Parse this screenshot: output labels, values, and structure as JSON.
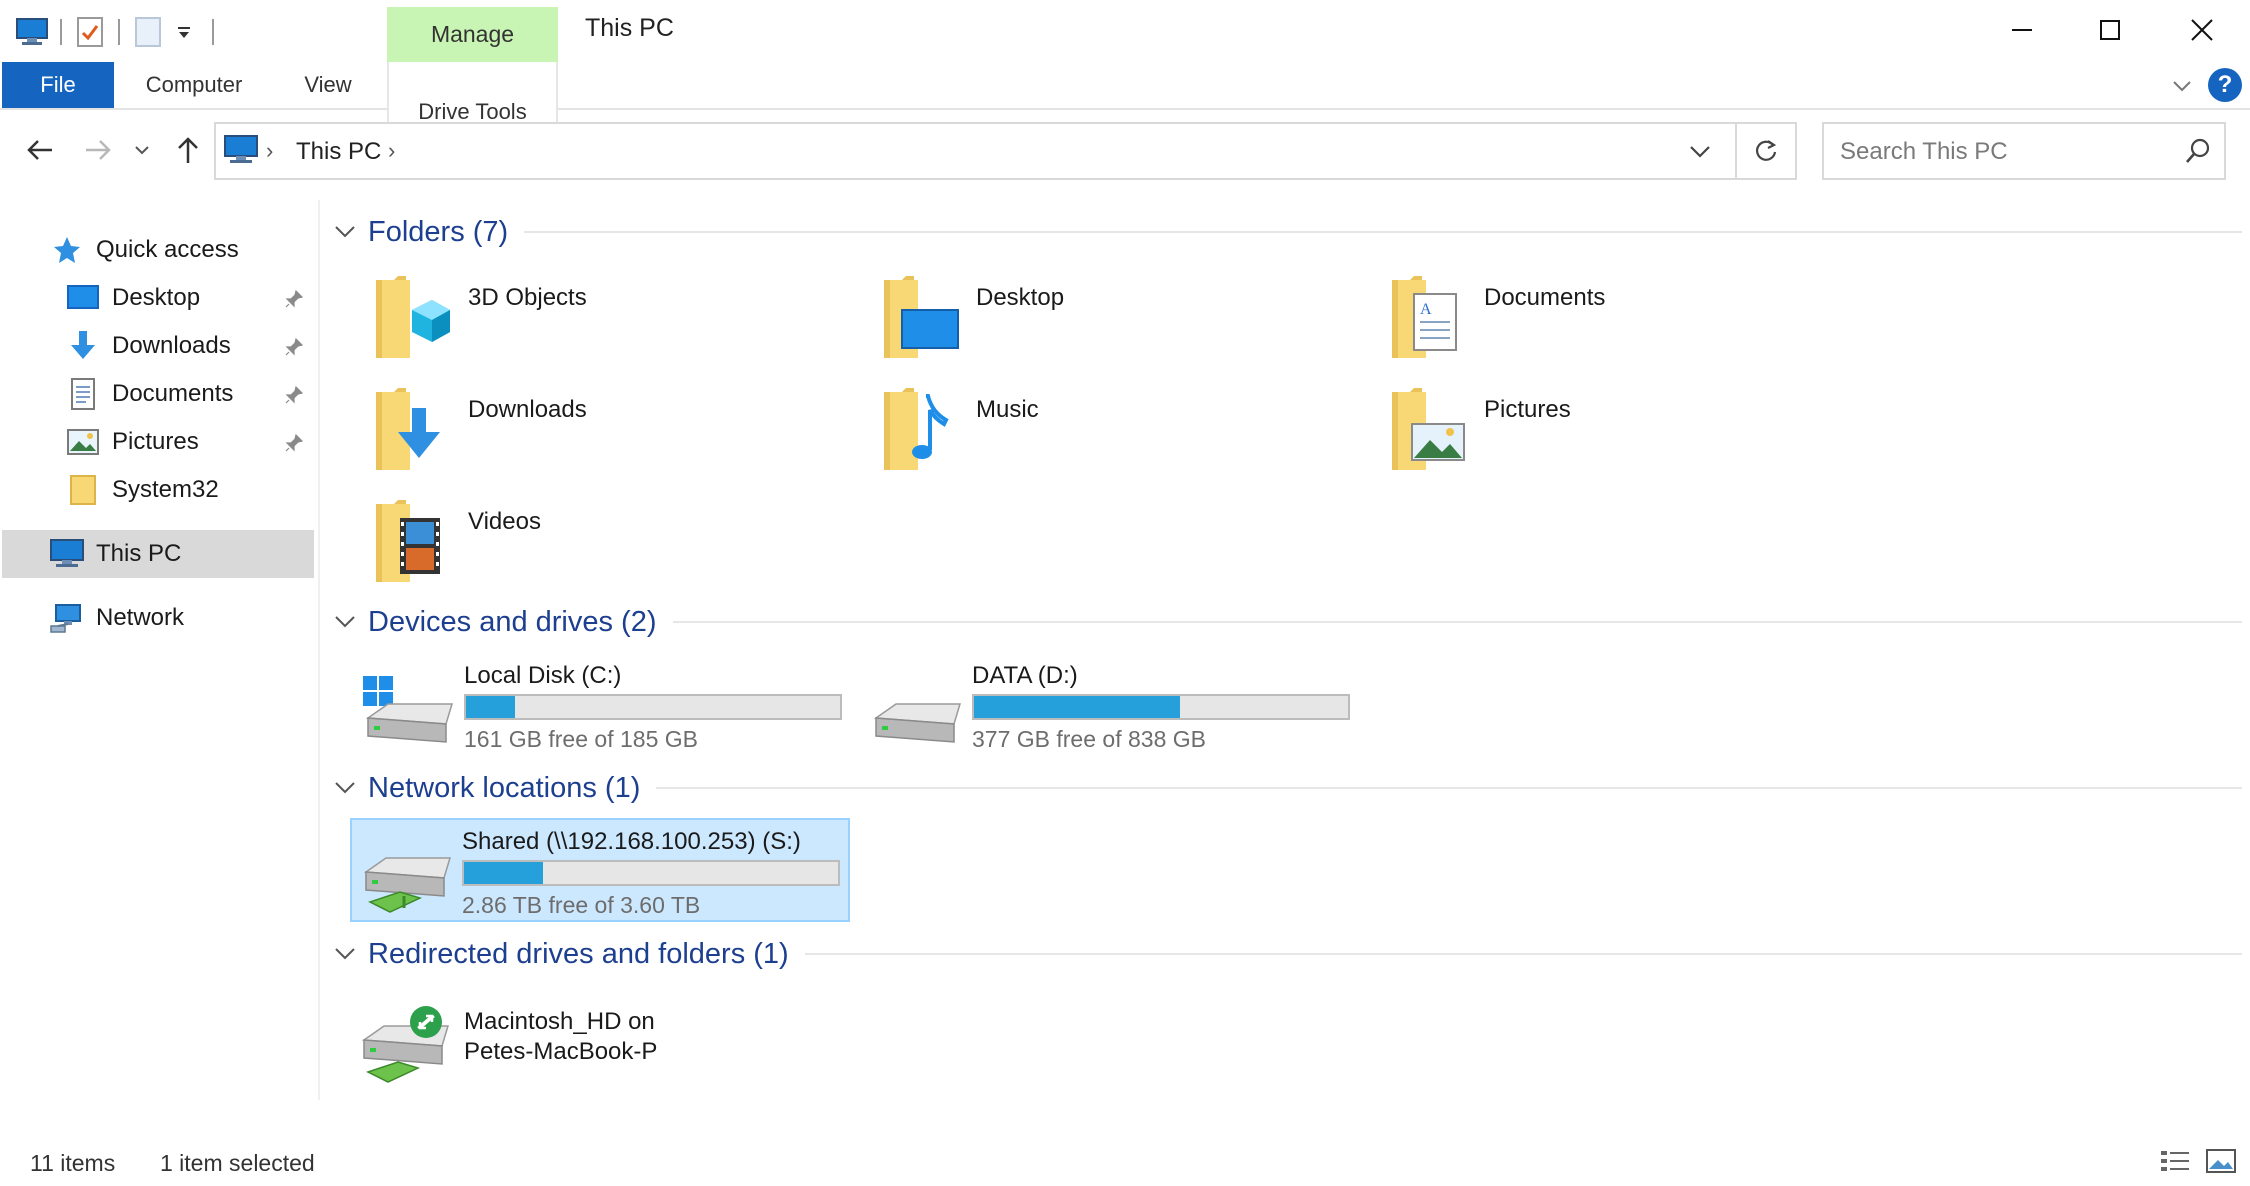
{
  "window": {
    "title": "This PC",
    "context_tab": "Manage",
    "accent": "#1565c0",
    "context_tab_color": "#c8f4b4"
  },
  "ribbon": {
    "tabs": [
      {
        "label": "File"
      },
      {
        "label": "Computer"
      },
      {
        "label": "View"
      },
      {
        "label": "Drive Tools"
      }
    ]
  },
  "address": {
    "crumb": "This PC",
    "search_placeholder": "Search This PC"
  },
  "sidebar": {
    "items": [
      {
        "label": "Quick access",
        "icon": "star-icon"
      },
      {
        "label": "Desktop",
        "icon": "desktop-icon",
        "pinned": true
      },
      {
        "label": "Downloads",
        "icon": "download-icon",
        "pinned": true
      },
      {
        "label": "Documents",
        "icon": "document-icon",
        "pinned": true
      },
      {
        "label": "Pictures",
        "icon": "picture-icon",
        "pinned": true
      },
      {
        "label": "System32",
        "icon": "folder-icon"
      },
      {
        "label": "This PC",
        "icon": "computer-icon",
        "selected": true
      },
      {
        "label": "Network",
        "icon": "network-icon"
      }
    ]
  },
  "groups": {
    "folders": {
      "title": "Folders (7)",
      "items": [
        "3D Objects",
        "Desktop",
        "Documents",
        "Downloads",
        "Music",
        "Pictures",
        "Videos"
      ]
    },
    "devices": {
      "title": "Devices and drives (2)",
      "items": [
        {
          "label": "Local Disk (C:)",
          "free": "161 GB free of 185 GB",
          "used_fraction": 0.13
        },
        {
          "label": "DATA (D:)",
          "free": "377 GB free of 838 GB",
          "used_fraction": 0.55
        }
      ]
    },
    "network": {
      "title": "Network locations (1)",
      "items": [
        {
          "label": "Shared (\\\\192.168.100.253) (S:)",
          "free": "2.86 TB free of 3.60 TB",
          "used_fraction": 0.21,
          "selected": true
        }
      ]
    },
    "redirected": {
      "title": "Redirected drives and folders (1)",
      "items": [
        {
          "line1": "Macintosh_HD on",
          "line2": "Petes-MacBook-P"
        }
      ]
    }
  },
  "status": {
    "items_count": "11 items",
    "selection": "1 item selected"
  }
}
